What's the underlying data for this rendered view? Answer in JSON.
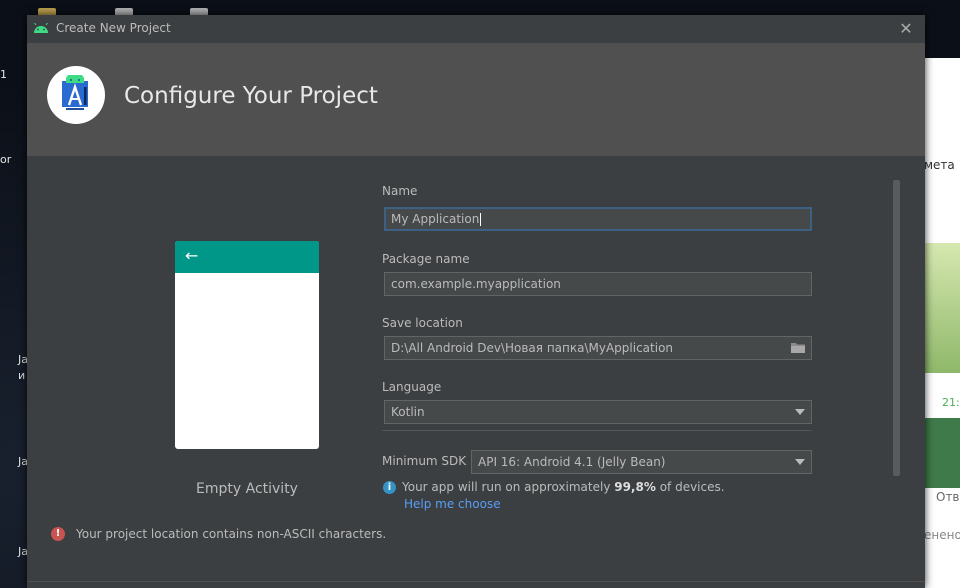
{
  "window": {
    "title": "Create New Project",
    "close_glyph": "✕"
  },
  "header": {
    "title": "Configure Your Project"
  },
  "preview": {
    "back_glyph": "←",
    "label": "Empty Activity"
  },
  "form": {
    "name_label": "Name",
    "name_value": "My Application",
    "package_label": "Package name",
    "package_value": "com.example.myapplication",
    "save_label": "Save location",
    "save_value": "D:\\All Android Dev\\Новая папка\\MyApplication",
    "language_label": "Language",
    "language_value": "Kotlin",
    "min_sdk_label": "Minimum SDK",
    "min_sdk_value": "API 16: Android 4.1 (Jelly Bean)",
    "info_prefix": "Your app will run on approximately ",
    "info_percent": "99,8%",
    "info_suffix": " of devices.",
    "help_link": "Help me choose"
  },
  "error": {
    "text": "Your project location contains non-ASCII characters."
  },
  "background_window": {
    "text_1": "мета",
    "text_2": "21:",
    "text_3": "Отв",
    "text_4": "ененo"
  },
  "desktop": {
    "labels": [
      "1",
      "or",
      "Ja",
      "и",
      "Ja",
      "Ja"
    ]
  },
  "colors": {
    "accent_teal": "#009688",
    "link_blue": "#589df6",
    "error_red": "#c75450",
    "focus_border": "#3d6185"
  }
}
